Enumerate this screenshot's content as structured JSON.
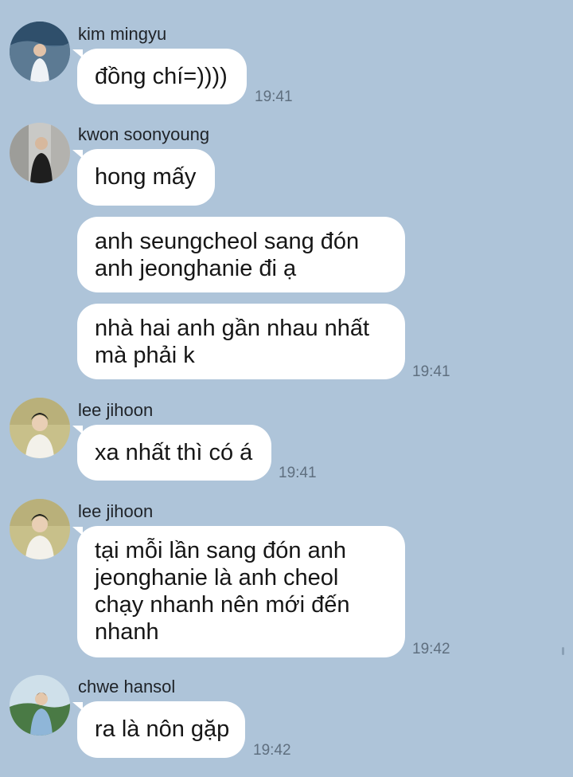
{
  "messages": [
    {
      "sender": "kim mingyu",
      "texts": [
        [
          "đồng chí=))))"
        ]
      ],
      "time": "19:41"
    },
    {
      "sender": "kwon soonyoung",
      "texts": [
        [
          "hong mấy"
        ],
        [
          "anh seungcheol sang đón",
          "anh jeonghanie đi ạ"
        ],
        [
          "nhà hai anh gần nhau nhất",
          "mà phải k"
        ]
      ],
      "time": "19:41"
    },
    {
      "sender": "lee jihoon",
      "texts": [
        [
          "xa nhất thì có á"
        ]
      ],
      "time": "19:41"
    },
    {
      "sender": "lee jihoon",
      "texts": [
        [
          "tại mỗi lần sang đón anh",
          "jeonghanie là anh cheol",
          "chạy nhanh nên mới đến",
          "nhanh"
        ]
      ],
      "time": "19:42"
    },
    {
      "sender": "chwe hansol",
      "texts": [
        [
          "ra là nôn gặp"
        ]
      ],
      "time": "19:42"
    }
  ],
  "avatars": [
    "avatar-kim-mingyu",
    "avatar-kwon-soonyoung",
    "avatar-lee-jihoon",
    "avatar-lee-jihoon",
    "avatar-chwe-hansol"
  ],
  "colors": {
    "background": "#aec4d9",
    "bubble": "#ffffff",
    "text": "#161616",
    "timestamp": "#5f6f7f"
  }
}
